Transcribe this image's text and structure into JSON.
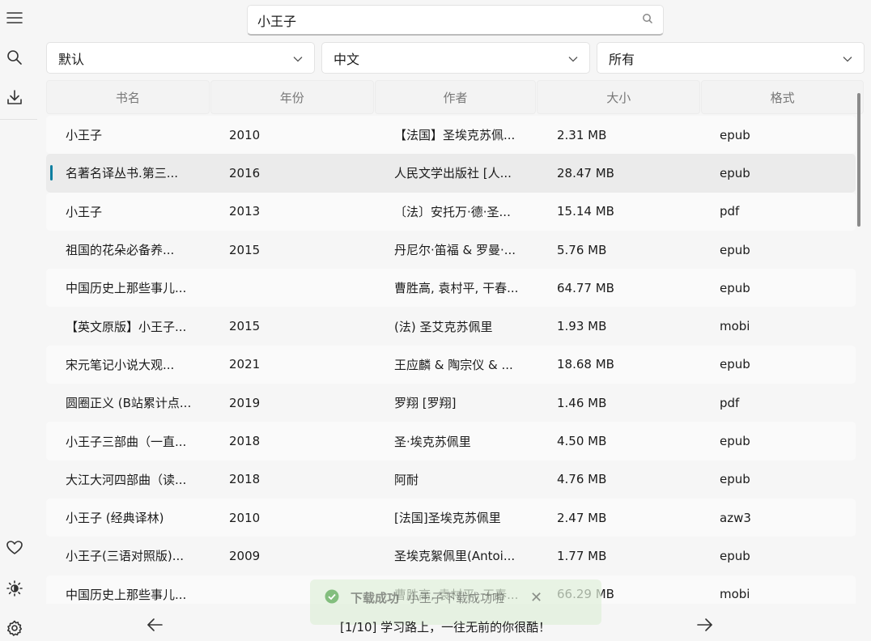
{
  "search": {
    "value": "小王子",
    "icon": "search-icon"
  },
  "sidebar": {
    "top_icons": [
      "menu-icon",
      "search-icon",
      "download-icon"
    ],
    "bottom_icons": [
      "heart-icon",
      "theme-icon",
      "settings-icon"
    ]
  },
  "filters": {
    "sort": "默认",
    "language": "中文",
    "format": "所有"
  },
  "table": {
    "headers": [
      "书名",
      "年份",
      "作者",
      "大小",
      "格式"
    ],
    "rows": [
      {
        "title": "小王子",
        "year": "2010",
        "author": "【法国】圣埃克苏佩...",
        "size": "2.31 MB",
        "ext": "epub"
      },
      {
        "title": "名著名译丛书.第三...",
        "year": "2016",
        "author": "人民文学出版社 [人...",
        "size": "28.47 MB",
        "ext": "epub"
      },
      {
        "title": "小王子",
        "year": "2013",
        "author": "〔法〕安托万·德·圣...",
        "size": "15.14 MB",
        "ext": "pdf"
      },
      {
        "title": "祖国的花朵必备养...",
        "year": "2015",
        "author": "丹尼尔·笛福 & 罗曼·...",
        "size": "5.76 MB",
        "ext": "epub"
      },
      {
        "title": "中国历史上那些事儿...",
        "year": "",
        "author": "曹胜高, 袁村平, 干春...",
        "size": "64.77 MB",
        "ext": "epub"
      },
      {
        "title": "【英文原版】小王子...",
        "year": "2015",
        "author": "(法) 圣艾克苏佩里",
        "size": "1.93 MB",
        "ext": "mobi"
      },
      {
        "title": "宋元笔记小说大观...",
        "year": "2021",
        "author": "王应麟 & 陶宗仪 & ...",
        "size": "18.68 MB",
        "ext": "epub"
      },
      {
        "title": "圆圈正义 (B站累计点...",
        "year": "2019",
        "author": "罗翔 [罗翔]",
        "size": "1.46 MB",
        "ext": "pdf"
      },
      {
        "title": "小王子三部曲（一直...",
        "year": "2018",
        "author": "圣·埃克苏佩里",
        "size": "4.50 MB",
        "ext": "epub"
      },
      {
        "title": "大江大河四部曲（读...",
        "year": "2018",
        "author": "阿耐",
        "size": "4.76 MB",
        "ext": "epub"
      },
      {
        "title": "小王子 (经典译林)",
        "year": "2010",
        "author": "[法国]圣埃克苏佩里",
        "size": "2.47 MB",
        "ext": "azw3"
      },
      {
        "title": "小王子(三语对照版)...",
        "year": "2009",
        "author": "圣埃克絮佩里(Antoi...",
        "size": "1.77 MB",
        "ext": "epub"
      },
      {
        "title": "中国历史上那些事儿...",
        "year": "",
        "author": "曹胜高, 袁村平, 干春...",
        "size": "66.29 MB",
        "ext": "mobi"
      }
    ],
    "selected_index": 1
  },
  "toast": {
    "title": "下载成功",
    "message": "小王子下载成功啦",
    "close": "✕"
  },
  "footer": {
    "quote": "[1/10] 学习路上，一往无前的你很酷！"
  },
  "colors": {
    "accent": "#0f7fa0",
    "toast_bg": "#dff0da",
    "toast_check": "#3f9b3b"
  }
}
